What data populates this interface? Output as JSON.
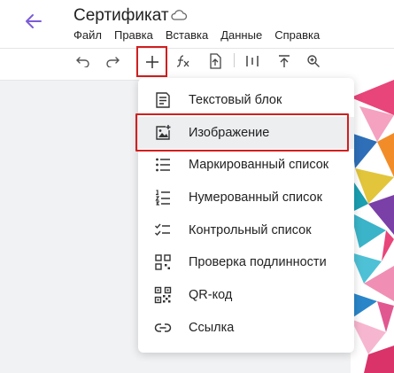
{
  "app": {
    "title": "Сертификат"
  },
  "menubar": {
    "items": [
      "Файл",
      "Правка",
      "Вставка",
      "Данные",
      "Справка"
    ]
  },
  "toolbar": {
    "icons": [
      "undo-icon",
      "redo-icon",
      "insert-plus-icon",
      "formula-icon",
      "import-icon",
      "columns-icon",
      "align-top-icon",
      "zoom-icon"
    ]
  },
  "insert_menu": {
    "items": [
      {
        "label": "Текстовый блок",
        "icon": "text-block-icon"
      },
      {
        "label": "Изображение",
        "icon": "image-icon"
      },
      {
        "label": "Маркированный список",
        "icon": "bulleted-list-icon"
      },
      {
        "label": "Нумерованный список",
        "icon": "numbered-list-icon"
      },
      {
        "label": "Контрольный список",
        "icon": "checklist-icon"
      },
      {
        "label": "Проверка подлинности",
        "icon": "authenticity-icon"
      },
      {
        "label": "QR-код",
        "icon": "qr-code-icon"
      },
      {
        "label": "Ссылка",
        "icon": "link-icon"
      }
    ],
    "selected": "Изображение"
  },
  "colors": {
    "accent": "#7b5cd6",
    "highlight": "#d11f1f"
  }
}
